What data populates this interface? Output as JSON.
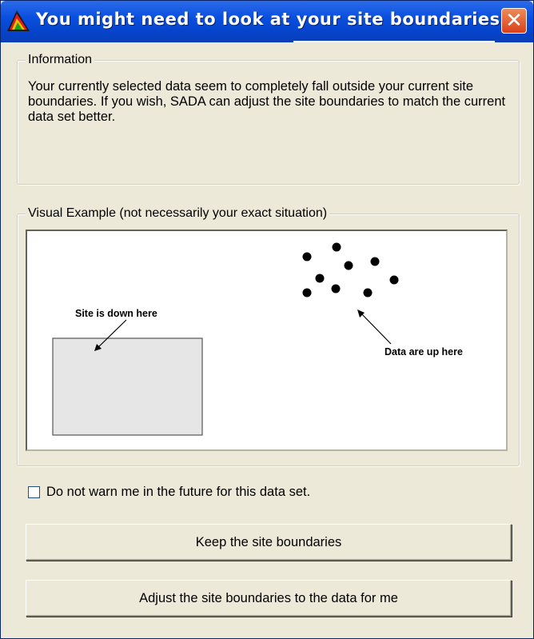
{
  "window": {
    "title": "You might need to look at your site boundaries...",
    "close_label": "✕",
    "app_icon": "sada-app-icon"
  },
  "information": {
    "group_label": "Information",
    "text": "Your currently selected data seem to completely fall outside your current site boundaries.  If you wish, SADA can adjust the site boundaries to match the current data set better."
  },
  "visual_example": {
    "group_label": "Visual Example (not necessarily your exact situation)",
    "site_label": "Site is down here",
    "data_label": "Data are up here"
  },
  "options": {
    "dont_warn_label": "Do not warn me in the future for this data set.",
    "dont_warn_checked": false
  },
  "buttons": {
    "keep_label": "Keep the site boundaries",
    "adjust_label": "Adjust the site boundaries to the data for me"
  }
}
